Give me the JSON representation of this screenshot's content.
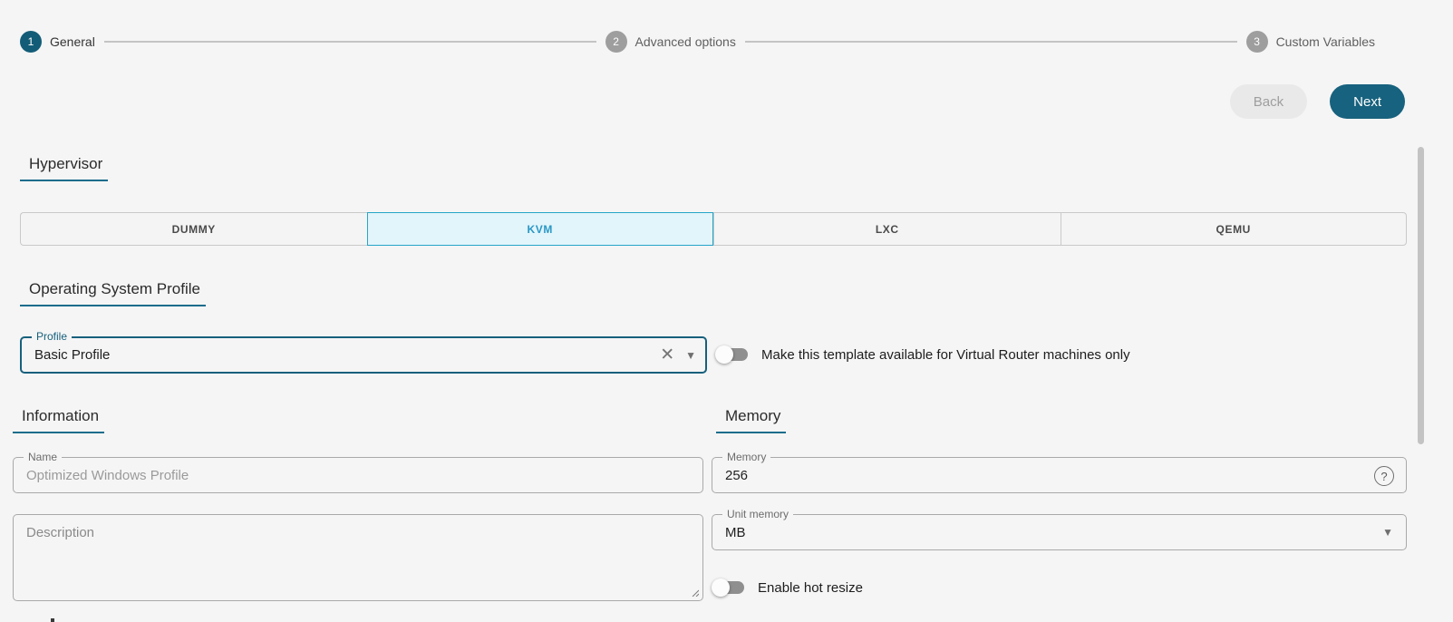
{
  "stepper": {
    "steps": [
      {
        "number": "1",
        "label": "General",
        "state": "active"
      },
      {
        "number": "2",
        "label": "Advanced options",
        "state": "inactive"
      },
      {
        "number": "3",
        "label": "Custom Variables",
        "state": "inactive"
      }
    ]
  },
  "actions": {
    "back_label": "Back",
    "next_label": "Next"
  },
  "hypervisor": {
    "heading": "Hypervisor",
    "options": [
      {
        "label": "DUMMY",
        "selected": false
      },
      {
        "label": "KVM",
        "selected": true
      },
      {
        "label": "LXC",
        "selected": false
      },
      {
        "label": "QEMU",
        "selected": false
      }
    ]
  },
  "os_profile": {
    "heading": "Operating System Profile",
    "profile_field": {
      "label": "Profile",
      "value": "Basic Profile"
    },
    "vrouter_toggle": {
      "label": "Make this template available for Virtual Router machines only",
      "state": "off"
    }
  },
  "information": {
    "heading": "Information",
    "name_field": {
      "label": "Name",
      "placeholder": "Optimized Windows Profile",
      "value": ""
    },
    "description_field": {
      "placeholder": "Description",
      "value": ""
    }
  },
  "memory": {
    "heading": "Memory",
    "memory_field": {
      "label": "Memory",
      "value": "256"
    },
    "unit_field": {
      "label": "Unit memory",
      "value": "MB"
    },
    "hot_resize_toggle": {
      "label": "Enable hot resize",
      "state": "off"
    }
  },
  "icons": {
    "clear_icon": "✕",
    "dropdown_icon": "▼",
    "help_icon": "?"
  },
  "colors": {
    "primary_teal": "#17627e",
    "step_active": "#135c77",
    "heading_underline": "#1a6d8c",
    "kvm_selected_bg": "#e1f5fb",
    "kvm_selected_border": "#25a5c9",
    "kvm_selected_text": "#2a97c5",
    "page_bg": "#f5f5f5",
    "field_border": "#a9a9a9",
    "back_btn_bg": "#e9e9e9",
    "scrollbar": "#c3c3c3"
  }
}
